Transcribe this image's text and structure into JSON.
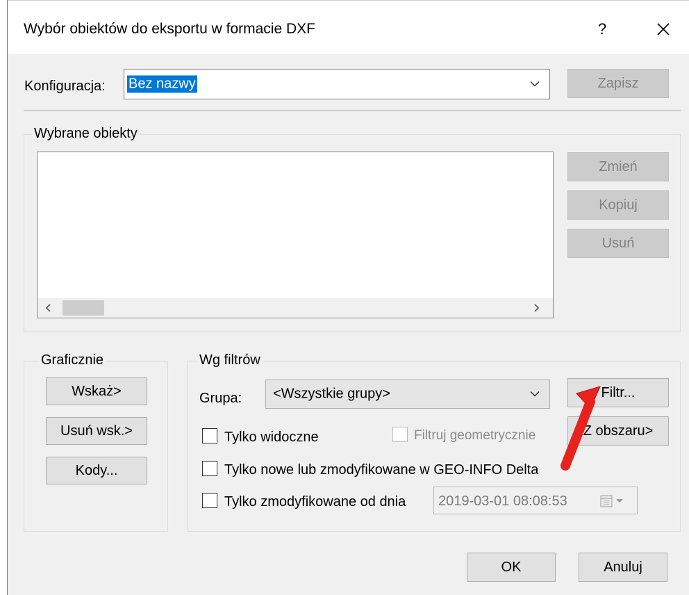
{
  "window": {
    "title": "Wybór obiektów do eksportu w formacie DXF",
    "help_label": "?"
  },
  "config": {
    "label": "Konfiguracja:",
    "value": "Bez nazwy",
    "save_label": "Zapisz"
  },
  "selected": {
    "group_label": "Wybrane obiekty",
    "change_label": "Zmień",
    "copy_label": "Kopiuj",
    "delete_label": "Usuń"
  },
  "graphic": {
    "group_label": "Graficznie",
    "point_label": "Wskaż>",
    "unpoint_label": "Usuń wsk.>",
    "codes_label": "Kody..."
  },
  "filters": {
    "group_label": "Wg filtrów",
    "group_field_label": "Grupa:",
    "group_value": "<Wszystkie grupy>",
    "filter_label": "Filtr...",
    "from_area_label": "Z obszaru>",
    "only_visible_label": "Tylko widoczne",
    "filter_geom_label": "Filtruj geometrycznie",
    "only_new_label": "Tylko nowe lub zmodyfikowane w GEO-INFO Delta",
    "only_modified_label": "Tylko zmodyfikowane od dnia",
    "date_value": "2019-03-01 08:08:53"
  },
  "footer": {
    "ok_label": "OK",
    "cancel_label": "Anuluj"
  },
  "colors": {
    "annotation_arrow": "#e8231e",
    "selection": "#0078d7"
  }
}
